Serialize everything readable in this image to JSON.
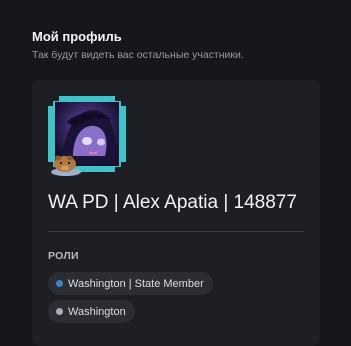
{
  "header": {
    "title": "Мой профиль",
    "subtitle": "Так будут видеть вас остальные участники."
  },
  "profile": {
    "display_name": "WA PD | Alex Apatia | 148877",
    "avatar_decoration_icon": "capybara-icon",
    "avatar_frame_color": "#3fc3c9"
  },
  "roles": {
    "heading": "РОЛИ",
    "items": [
      {
        "label": "Washington | State Member",
        "color": "#3b84c4"
      },
      {
        "label": "Washington",
        "color": "#a9b0bb"
      }
    ]
  }
}
